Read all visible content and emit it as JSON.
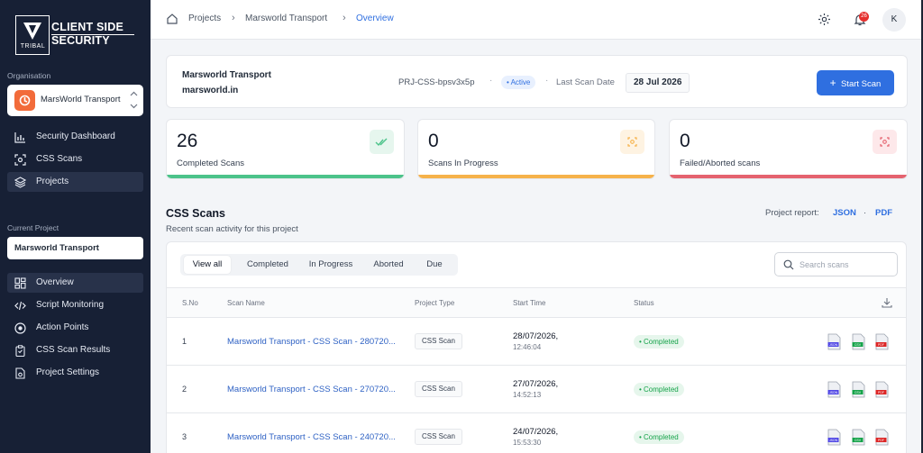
{
  "sidebar": {
    "logo_text_line1": "CLIENT SIDE",
    "logo_text_line2": "SECURITY",
    "logo_tribal": "TRIBAL",
    "org_label": "Organisation",
    "org_name": "MarsWorld Transport",
    "items": [
      {
        "label": "Security Dashboard",
        "icon": "bar-chart-icon"
      },
      {
        "label": "CSS Scans",
        "icon": "scan-icon"
      },
      {
        "label": "Projects",
        "icon": "layers-icon"
      }
    ],
    "current_project_label": "Current Project",
    "current_project": "Marsworld Transport",
    "project_items": [
      {
        "label": "Overview",
        "icon": "grid-icon"
      },
      {
        "label": "Script Monitoring",
        "icon": "code-icon"
      },
      {
        "label": "Action Points",
        "icon": "target-icon"
      },
      {
        "label": "CSS Scan Results",
        "icon": "clipboard-icon"
      },
      {
        "label": "Project Settings",
        "icon": "file-gear-icon"
      }
    ]
  },
  "breadcrumb": {
    "home_icon": "home-icon",
    "items": [
      "Projects",
      "Marsworld Transport",
      "Overview"
    ]
  },
  "topbar": {
    "notification_count": "26",
    "avatar_initial": "K"
  },
  "project": {
    "name": "Marsworld Transport",
    "domain": "marsworld.in",
    "id": "PRJ-CSS-bpsv3x5p",
    "status": "Active",
    "last_scan_label": "Last Scan Date",
    "last_scan_date": "28 Jul 2026",
    "start_scan_label": "Start Scan"
  },
  "stats": [
    {
      "value": "26",
      "label": "Completed Scans",
      "color": "#4cc38a"
    },
    {
      "value": "0",
      "label": "Scans In Progress",
      "color": "#f6b24a"
    },
    {
      "value": "0",
      "label": "Failed/Aborted scans",
      "color": "#e5636f"
    }
  ],
  "scans": {
    "title": "CSS Scans",
    "subtitle": "Recent scan activity for this project",
    "report_label": "Project report:",
    "report_json": "JSON",
    "report_pdf": "PDF",
    "tabs": [
      "View all",
      "Completed",
      "In Progress",
      "Aborted",
      "Due"
    ],
    "search_placeholder": "Search scans",
    "columns": [
      "S.No",
      "Scan Name",
      "Project Type",
      "Start Time",
      "Status"
    ],
    "rows": [
      {
        "no": "1",
        "name": "Marsworld Transport - CSS Scan - 280720...",
        "type": "CSS Scan",
        "date": "28/07/2026,",
        "time": "12:46:04",
        "status": "Completed"
      },
      {
        "no": "2",
        "name": "Marsworld Transport - CSS Scan - 270720...",
        "type": "CSS Scan",
        "date": "27/07/2026,",
        "time": "14:52:13",
        "status": "Completed"
      },
      {
        "no": "3",
        "name": "Marsworld Transport - CSS Scan - 240720...",
        "type": "CSS Scan",
        "date": "24/07/2026,",
        "time": "15:53:30",
        "status": "Completed"
      }
    ],
    "file_labels": [
      "JSON",
      "CSV",
      "PDF"
    ]
  }
}
